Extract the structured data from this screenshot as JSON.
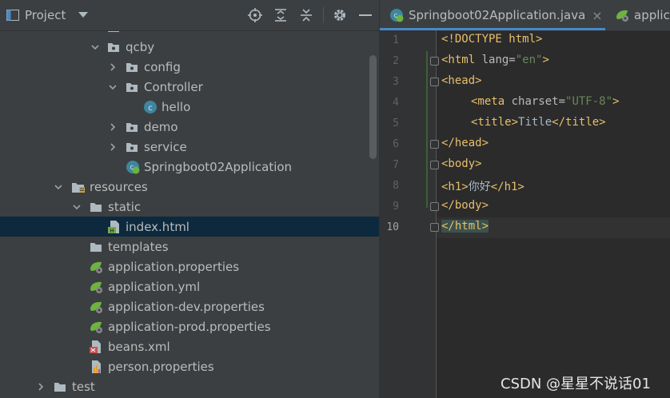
{
  "project_panel": {
    "title": "Project",
    "tree": [
      {
        "label": "com",
        "type": "package",
        "expanded": true
      },
      {
        "label": "qcby",
        "type": "package",
        "expanded": true
      },
      {
        "label": "config",
        "type": "package",
        "expanded": false
      },
      {
        "label": "Controller",
        "type": "package",
        "expanded": true
      },
      {
        "label": "hello",
        "type": "class"
      },
      {
        "label": "demo",
        "type": "package",
        "expanded": false
      },
      {
        "label": "service",
        "type": "package",
        "expanded": false
      },
      {
        "label": "Springboot02Application",
        "type": "spring-class"
      },
      {
        "label": "resources",
        "type": "resources-folder",
        "expanded": true
      },
      {
        "label": "static",
        "type": "folder",
        "expanded": true
      },
      {
        "label": "index.html",
        "type": "html-file",
        "selected": true
      },
      {
        "label": "templates",
        "type": "folder"
      },
      {
        "label": "application.properties",
        "type": "spring-config"
      },
      {
        "label": "application.yml",
        "type": "spring-config"
      },
      {
        "label": "application-dev.properties",
        "type": "spring-config"
      },
      {
        "label": "application-prod.properties",
        "type": "spring-config"
      },
      {
        "label": "beans.xml",
        "type": "xml-file"
      },
      {
        "label": "person.properties",
        "type": "properties-file"
      },
      {
        "label": "test",
        "type": "folder",
        "expanded": false
      }
    ]
  },
  "editor": {
    "tabs": [
      {
        "label": "Springboot02Application.java",
        "active": true,
        "close": "×"
      },
      {
        "label": "applica",
        "active": false
      }
    ],
    "line_numbers": [
      "1",
      "2",
      "3",
      "4",
      "5",
      "6",
      "7",
      "8",
      "9",
      "10"
    ],
    "current_line": "10",
    "code": {
      "l1": "<!DOCTYPE html>",
      "l2_tag_open": "<html",
      "l2_attr": " lang=",
      "l2_val": "\"en\"",
      "l2_close": ">",
      "l3": "<head>",
      "l4_tag_open": "<meta",
      "l4_attr": " charset=",
      "l4_val": "\"UTF-8\"",
      "l4_close": ">",
      "l5_open": "<title>",
      "l5_text": "Title",
      "l5_close": "</title>",
      "l6": "</head>",
      "l7": "<body>",
      "l8_open": "<h1>",
      "l8_text": "你好",
      "l8_close": "</h1>",
      "l9": "</body>",
      "l10": "</html>"
    }
  },
  "watermark": "CSDN @星星不说话01",
  "colors": {
    "panel_bg": "#3c3f41",
    "editor_bg": "#2b2b2b",
    "selection": "#0d293e",
    "tag": "#e8bf6a",
    "string": "#6a8759",
    "folder": "#aeb9c0",
    "spring_green": "#6db33f",
    "class_blue": "#3e86a0"
  }
}
